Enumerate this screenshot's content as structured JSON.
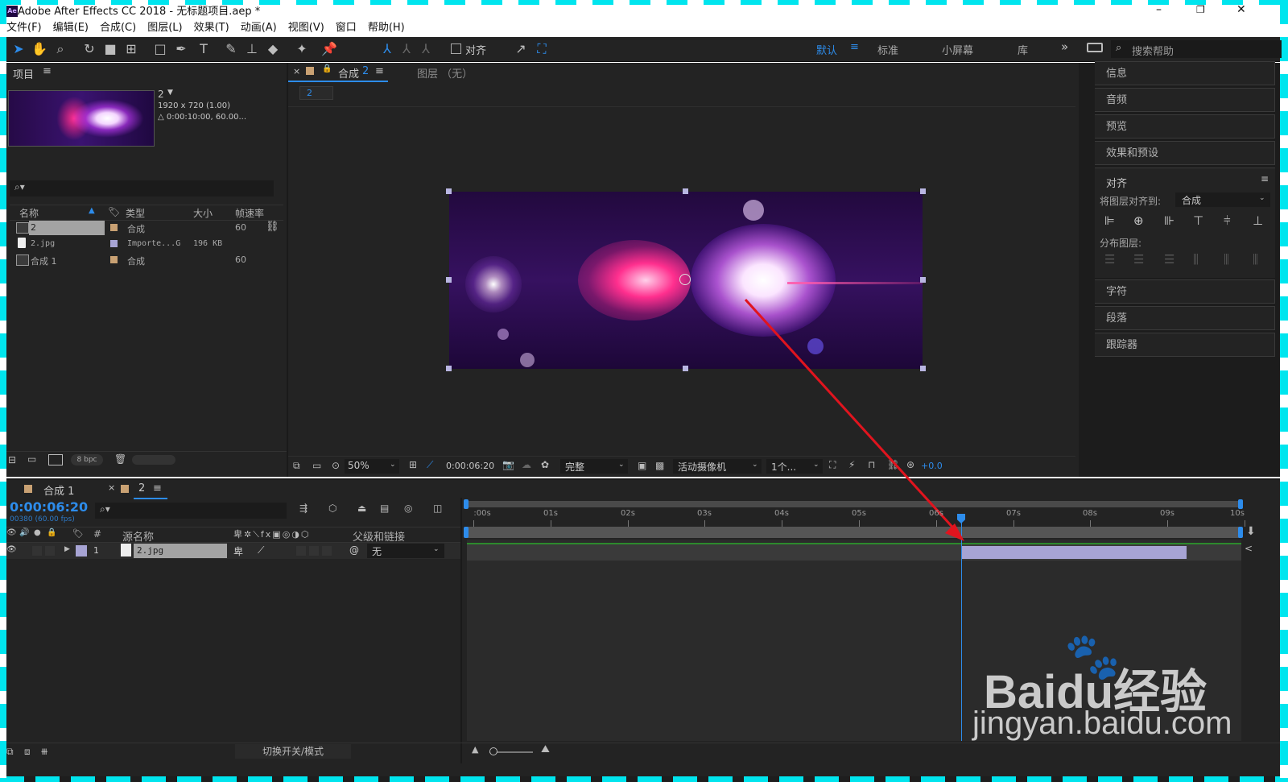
{
  "window": {
    "title": "Adobe After Effects CC 2018 - 无标题项目.aep *",
    "app_icon": "Ae"
  },
  "menu": [
    "文件(F)",
    "编辑(E)",
    "合成(C)",
    "图层(L)",
    "效果(T)",
    "动画(A)",
    "视图(V)",
    "窗口",
    "帮助(H)"
  ],
  "toolbar": {
    "snap_label": "对齐",
    "workspaces": [
      "默认",
      "标准",
      "小屏幕",
      "库"
    ],
    "more": "»",
    "search_placeholder": "搜索帮助"
  },
  "project": {
    "title": "项目",
    "menu_icon": "≡",
    "item_name": "2",
    "item_dims": "1920 x 720 (1.00)",
    "item_duration": "△ 0:00:10:00, 60.00...",
    "columns": [
      "名称",
      "类型",
      "大小",
      "帧速率"
    ],
    "rows": [
      {
        "name": "2",
        "type": "合成",
        "size": "",
        "fps": "60"
      },
      {
        "name": "2.jpg",
        "type": "Importe...G",
        "size": "196 KB",
        "fps": ""
      },
      {
        "name": "合成 1",
        "type": "合成",
        "size": "",
        "fps": "60"
      }
    ],
    "bpc": "8 bpc"
  },
  "comp_viewer": {
    "tab_label": "合成",
    "tab_number": "2",
    "layer_tab": "图层 （无）",
    "breadcrumb": "2",
    "zoom": "50%",
    "timecode": "0:00:06:20",
    "resolution": "完整",
    "camera": "活动摄像机",
    "views": "1个...",
    "exposure": "+0.0"
  },
  "right_panel": {
    "items_top": [
      "信息",
      "音频",
      "预览",
      "效果和预设"
    ],
    "align": {
      "title": "对齐",
      "align_to_label": "将图层对齐到:",
      "align_to_value": "合成",
      "distribute_label": "分布图层:"
    },
    "items_bottom": [
      "字符",
      "段落",
      "跟踪器"
    ]
  },
  "timeline": {
    "tabs": [
      {
        "label": "合成 1"
      },
      {
        "label": "2"
      }
    ],
    "current_time": "0:00:06:20",
    "frame_info": "00380 (60.00 fps)",
    "columns": {
      "num": "#",
      "source": "源名称",
      "parent": "父级和链接"
    },
    "layer": {
      "num": "1",
      "name": "2.jpg",
      "parent": "无"
    },
    "ruler": [
      ":00s",
      "01s",
      "02s",
      "03s",
      "04s",
      "05s",
      "06s",
      "07s",
      "08s",
      "09s",
      "10s"
    ],
    "playhead_seconds": 6.33,
    "layer_in_seconds": 6.33,
    "layer_out_seconds": 9.25,
    "duration_seconds": 10,
    "footer_toggle": "切换开关/模式"
  },
  "watermark": {
    "brand": "Baidu经验",
    "url": "jingyan.baidu.com"
  },
  "colors": {
    "accent_blue": "#2d8ceb",
    "arrow_red": "#e0141e",
    "layer_bar": "#a7a4d4",
    "panel_bg": "#232323"
  }
}
